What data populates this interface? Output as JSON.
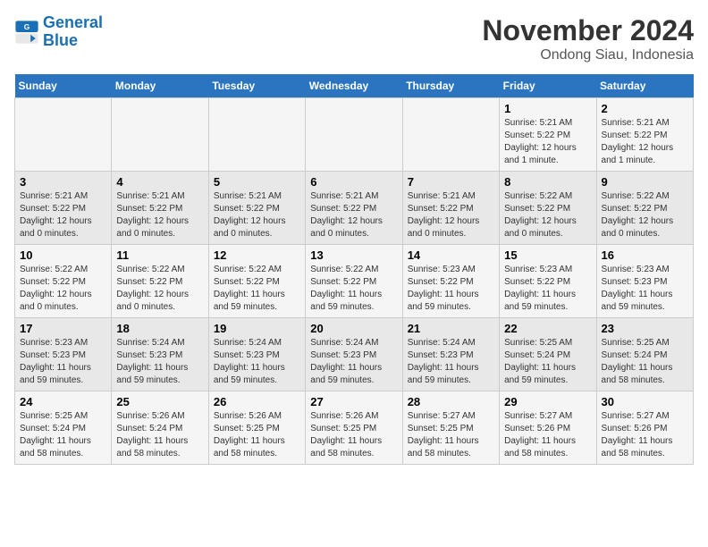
{
  "logo": {
    "name_part1": "General",
    "name_part2": "Blue"
  },
  "title": "November 2024",
  "subtitle": "Ondong Siau, Indonesia",
  "days_header": [
    "Sunday",
    "Monday",
    "Tuesday",
    "Wednesday",
    "Thursday",
    "Friday",
    "Saturday"
  ],
  "weeks": [
    [
      {
        "day": "",
        "info": ""
      },
      {
        "day": "",
        "info": ""
      },
      {
        "day": "",
        "info": ""
      },
      {
        "day": "",
        "info": ""
      },
      {
        "day": "",
        "info": ""
      },
      {
        "day": "1",
        "info": "Sunrise: 5:21 AM\nSunset: 5:22 PM\nDaylight: 12 hours and 1 minute."
      },
      {
        "day": "2",
        "info": "Sunrise: 5:21 AM\nSunset: 5:22 PM\nDaylight: 12 hours and 1 minute."
      }
    ],
    [
      {
        "day": "3",
        "info": "Sunrise: 5:21 AM\nSunset: 5:22 PM\nDaylight: 12 hours and 0 minutes."
      },
      {
        "day": "4",
        "info": "Sunrise: 5:21 AM\nSunset: 5:22 PM\nDaylight: 12 hours and 0 minutes."
      },
      {
        "day": "5",
        "info": "Sunrise: 5:21 AM\nSunset: 5:22 PM\nDaylight: 12 hours and 0 minutes."
      },
      {
        "day": "6",
        "info": "Sunrise: 5:21 AM\nSunset: 5:22 PM\nDaylight: 12 hours and 0 minutes."
      },
      {
        "day": "7",
        "info": "Sunrise: 5:21 AM\nSunset: 5:22 PM\nDaylight: 12 hours and 0 minutes."
      },
      {
        "day": "8",
        "info": "Sunrise: 5:22 AM\nSunset: 5:22 PM\nDaylight: 12 hours and 0 minutes."
      },
      {
        "day": "9",
        "info": "Sunrise: 5:22 AM\nSunset: 5:22 PM\nDaylight: 12 hours and 0 minutes."
      }
    ],
    [
      {
        "day": "10",
        "info": "Sunrise: 5:22 AM\nSunset: 5:22 PM\nDaylight: 12 hours and 0 minutes."
      },
      {
        "day": "11",
        "info": "Sunrise: 5:22 AM\nSunset: 5:22 PM\nDaylight: 12 hours and 0 minutes."
      },
      {
        "day": "12",
        "info": "Sunrise: 5:22 AM\nSunset: 5:22 PM\nDaylight: 11 hours and 59 minutes."
      },
      {
        "day": "13",
        "info": "Sunrise: 5:22 AM\nSunset: 5:22 PM\nDaylight: 11 hours and 59 minutes."
      },
      {
        "day": "14",
        "info": "Sunrise: 5:23 AM\nSunset: 5:22 PM\nDaylight: 11 hours and 59 minutes."
      },
      {
        "day": "15",
        "info": "Sunrise: 5:23 AM\nSunset: 5:22 PM\nDaylight: 11 hours and 59 minutes."
      },
      {
        "day": "16",
        "info": "Sunrise: 5:23 AM\nSunset: 5:23 PM\nDaylight: 11 hours and 59 minutes."
      }
    ],
    [
      {
        "day": "17",
        "info": "Sunrise: 5:23 AM\nSunset: 5:23 PM\nDaylight: 11 hours and 59 minutes."
      },
      {
        "day": "18",
        "info": "Sunrise: 5:24 AM\nSunset: 5:23 PM\nDaylight: 11 hours and 59 minutes."
      },
      {
        "day": "19",
        "info": "Sunrise: 5:24 AM\nSunset: 5:23 PM\nDaylight: 11 hours and 59 minutes."
      },
      {
        "day": "20",
        "info": "Sunrise: 5:24 AM\nSunset: 5:23 PM\nDaylight: 11 hours and 59 minutes."
      },
      {
        "day": "21",
        "info": "Sunrise: 5:24 AM\nSunset: 5:23 PM\nDaylight: 11 hours and 59 minutes."
      },
      {
        "day": "22",
        "info": "Sunrise: 5:25 AM\nSunset: 5:24 PM\nDaylight: 11 hours and 59 minutes."
      },
      {
        "day": "23",
        "info": "Sunrise: 5:25 AM\nSunset: 5:24 PM\nDaylight: 11 hours and 58 minutes."
      }
    ],
    [
      {
        "day": "24",
        "info": "Sunrise: 5:25 AM\nSunset: 5:24 PM\nDaylight: 11 hours and 58 minutes."
      },
      {
        "day": "25",
        "info": "Sunrise: 5:26 AM\nSunset: 5:24 PM\nDaylight: 11 hours and 58 minutes."
      },
      {
        "day": "26",
        "info": "Sunrise: 5:26 AM\nSunset: 5:25 PM\nDaylight: 11 hours and 58 minutes."
      },
      {
        "day": "27",
        "info": "Sunrise: 5:26 AM\nSunset: 5:25 PM\nDaylight: 11 hours and 58 minutes."
      },
      {
        "day": "28",
        "info": "Sunrise: 5:27 AM\nSunset: 5:25 PM\nDaylight: 11 hours and 58 minutes."
      },
      {
        "day": "29",
        "info": "Sunrise: 5:27 AM\nSunset: 5:26 PM\nDaylight: 11 hours and 58 minutes."
      },
      {
        "day": "30",
        "info": "Sunrise: 5:27 AM\nSunset: 5:26 PM\nDaylight: 11 hours and 58 minutes."
      }
    ]
  ]
}
